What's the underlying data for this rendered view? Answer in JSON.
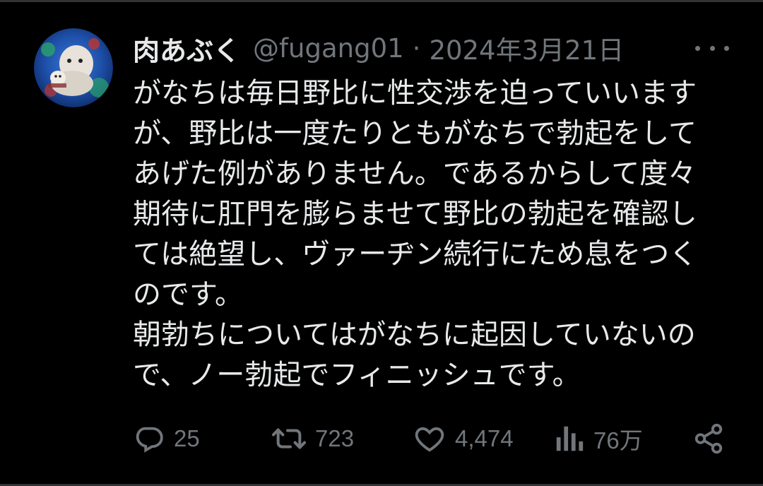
{
  "tweet": {
    "display_name": "肉あぶく",
    "handle": "@fugang01",
    "separator": "·",
    "date": "2024年3月21日",
    "lines": [
      "がなちは毎日野比に性交渉を迫っていいます",
      "が、野比は一度たりともがなちで勃起をして",
      "あげた例がありません。であるからして度々",
      "期待に肛門を膨らませて野比の勃起を確認し",
      "ては絶望し、ヴァーヂン続行にため息をつく",
      "のです。",
      "朝勃ちについてはがなちに起因していないの",
      "で、ノー勃起でフィニッシュです。"
    ]
  },
  "actions": {
    "reply": {
      "icon": "reply-icon",
      "count": "25"
    },
    "retweet": {
      "icon": "retweet-icon",
      "count": "723"
    },
    "like": {
      "icon": "heart-icon",
      "count": "4,474"
    },
    "views": {
      "icon": "views-icon",
      "count": "76万"
    },
    "share": {
      "icon": "share-icon"
    }
  },
  "colors": {
    "background": "#000000",
    "text": "#e7e9ea",
    "muted": "#71767b"
  }
}
